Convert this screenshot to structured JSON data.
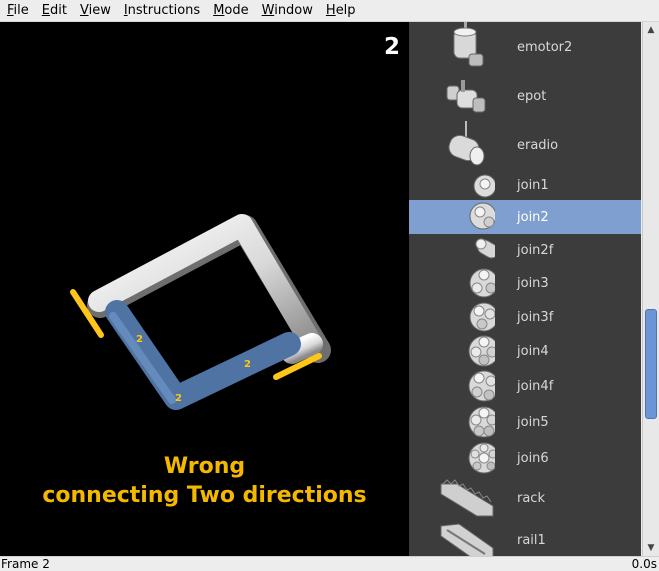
{
  "menu": [
    {
      "accel": "F",
      "rest": "ile"
    },
    {
      "accel": "E",
      "rest": "dit"
    },
    {
      "accel": "V",
      "rest": "iew"
    },
    {
      "accel": "I",
      "rest": "nstructions"
    },
    {
      "accel": "M",
      "rest": "ode"
    },
    {
      "accel": "W",
      "rest": "indow"
    },
    {
      "accel": "H",
      "rest": "elp"
    }
  ],
  "viewport": {
    "frame_number": "2",
    "segment_labels": [
      "2",
      "2",
      "2"
    ],
    "caption_line1": "Wrong",
    "caption_line2": "connecting Two directions",
    "caption_color": "#f5b800",
    "highlight_color": "#4f73a3"
  },
  "parts": [
    {
      "name": "emotor2",
      "icon": "emotor-part-icon"
    },
    {
      "name": "epot",
      "icon": "epot-part-icon"
    },
    {
      "name": "eradio",
      "icon": "eradio-part-icon"
    },
    {
      "name": "join1",
      "icon": "join-part-icon"
    },
    {
      "name": "join2",
      "icon": "join-part-icon",
      "selected": true
    },
    {
      "name": "join2f",
      "icon": "join-part-icon"
    },
    {
      "name": "join3",
      "icon": "join-part-icon"
    },
    {
      "name": "join3f",
      "icon": "join-part-icon"
    },
    {
      "name": "join4",
      "icon": "join-part-icon"
    },
    {
      "name": "join4f",
      "icon": "join-part-icon"
    },
    {
      "name": "join5",
      "icon": "join-part-icon"
    },
    {
      "name": "join6",
      "icon": "join-part-icon"
    },
    {
      "name": "rack",
      "icon": "rack-part-icon"
    },
    {
      "name": "rail1",
      "icon": "rail-part-icon"
    }
  ],
  "status": {
    "left": "Frame 2",
    "right": "0.0s"
  }
}
